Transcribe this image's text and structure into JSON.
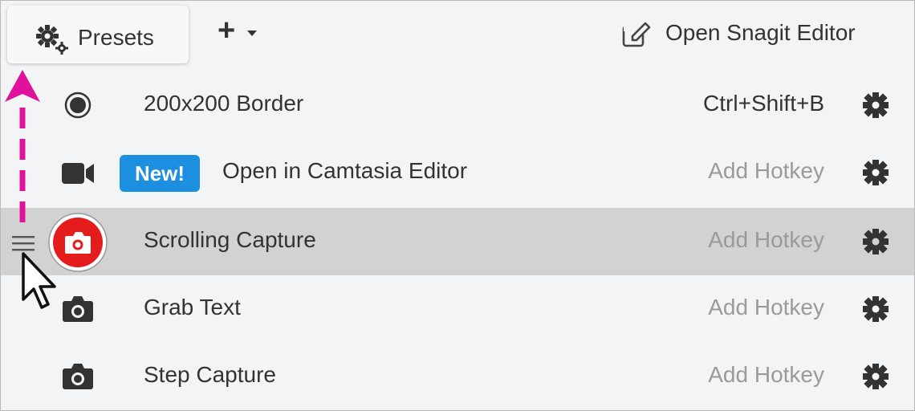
{
  "toolbar": {
    "presets_label": "Presets",
    "add_label": "+",
    "editor_label": "Open Snagit Editor"
  },
  "presets": [
    {
      "name": "200x200 Border",
      "hotkey": "Ctrl+Shift+B",
      "icon": "radio-filled-icon",
      "badge": ""
    },
    {
      "name": "Open in Camtasia Editor",
      "hotkey": "Add Hotkey",
      "icon": "video-camera-icon",
      "badge": "New!"
    },
    {
      "name": "Scrolling Capture",
      "hotkey": "Add Hotkey",
      "icon": "camera-red-icon",
      "badge": ""
    },
    {
      "name": "Grab Text",
      "hotkey": "Add Hotkey",
      "icon": "camera-icon",
      "badge": ""
    },
    {
      "name": "Step Capture",
      "hotkey": "Add Hotkey",
      "icon": "camera-icon",
      "badge": ""
    }
  ],
  "colors": {
    "accent": "#1d8fe1",
    "annotation": "#e0119a",
    "capture_red": "#e41c1c",
    "selected_row": "#d2d2d2"
  }
}
